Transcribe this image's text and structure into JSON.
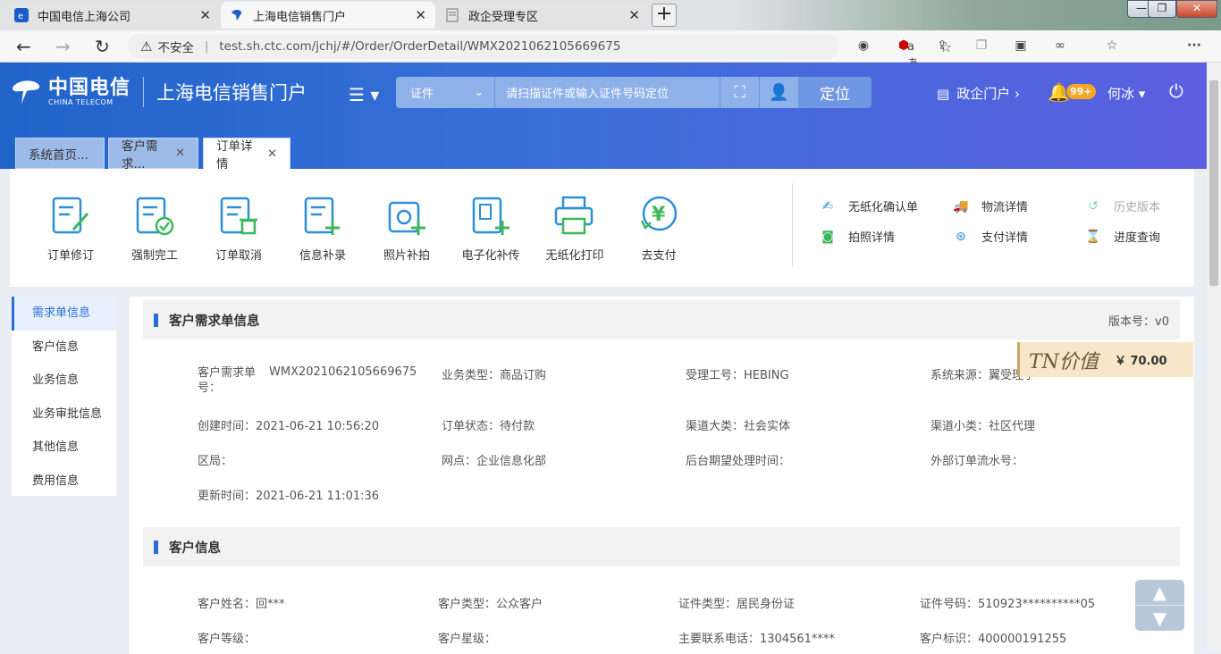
{
  "browser": {
    "tabs": [
      {
        "title": "中国电信上海公司",
        "active": false
      },
      {
        "title": "上海电信销售门户",
        "active": true
      },
      {
        "title": "政企受理专区",
        "active": false
      }
    ],
    "new_tab": "+",
    "window_min": "—",
    "window_restore": "❐",
    "window_close": "✕",
    "back": "←",
    "forward": "→",
    "reload": "↻",
    "security_label": "不安全",
    "url": "test.sh.ctc.com/jchj/#/Order/OrderDetail/WMX2021062105669675",
    "read_aloud": "aあ"
  },
  "header": {
    "logo_cn": "中国电信",
    "logo_en": "CHINA TELECOM",
    "portal_title": "上海电信销售门户",
    "cert_type": "证件",
    "search_placeholder": "请扫描证件或输入证件号码定位",
    "locate_button": "定位",
    "gov_portal": "政企门户 ›",
    "notification_count": "99+",
    "user_name": "何冰"
  },
  "page_tabs": [
    {
      "label": "系统首页...",
      "closable": false
    },
    {
      "label": "客户需求...",
      "closable": true
    },
    {
      "label": "订单详情",
      "closable": true
    }
  ],
  "toolbar": {
    "tools": [
      "订单修订",
      "强制完工",
      "订单取消",
      "信息补录",
      "照片补拍",
      "电子化补传",
      "无纸化打印",
      "去支付"
    ],
    "links": [
      {
        "label": "无纸化确认单",
        "icon": "document-check-icon"
      },
      {
        "label": "物流详情",
        "icon": "truck-icon"
      },
      {
        "label": "历史版本",
        "icon": "history-icon",
        "disabled": true
      },
      {
        "label": "拍照详情",
        "icon": "camera-icon"
      },
      {
        "label": "支付详情",
        "icon": "payment-icon"
      },
      {
        "label": "进度查询",
        "icon": "hourglass-icon"
      }
    ]
  },
  "sidenav": [
    "需求单信息",
    "客户信息",
    "业务信息",
    "业务审批信息",
    "其他信息",
    "费用信息"
  ],
  "sections": {
    "demand": {
      "title": "客户需求单信息",
      "version": "版本号：v0",
      "fields": {
        "order_no_label": "客户需求单号：",
        "order_no": "WMX2021062105669675",
        "biz_type": "业务类型：商品订购",
        "handler_id": "受理工号：HEBING",
        "source": "系统来源：翼受理小",
        "created": "创建时间：2021-06-21 10:56:20",
        "status": "订单状态：待付款",
        "channel_major": "渠道大类：社会实体",
        "channel_minor": "渠道小类：社区代理",
        "district": "区局：",
        "outlet": "网点：企业信息化部",
        "expected_time": "后台期望处理时间：",
        "external_no": "外部订单流水号：",
        "updated": "更新时间：2021-06-21 11:01:36"
      }
    },
    "customer": {
      "title": "客户信息",
      "fields": {
        "name": "客户姓名：回***",
        "type": "客户类型：公众客户",
        "id_type": "证件类型：居民身份证",
        "id_no": "证件号码：510923**********05",
        "level": "客户等级：",
        "star": "客户星级：",
        "phone": "主要联系电话：1304561****",
        "cust_id": "客户标识：400000191255"
      }
    }
  },
  "tn_value": {
    "label": "TN价值",
    "amount": "￥ 70.00"
  },
  "colors": {
    "primary": "#2b6cd6",
    "header_start": "#2064ca",
    "header_end": "#5b5fe0",
    "tn_bg": "#f7e6c8"
  }
}
